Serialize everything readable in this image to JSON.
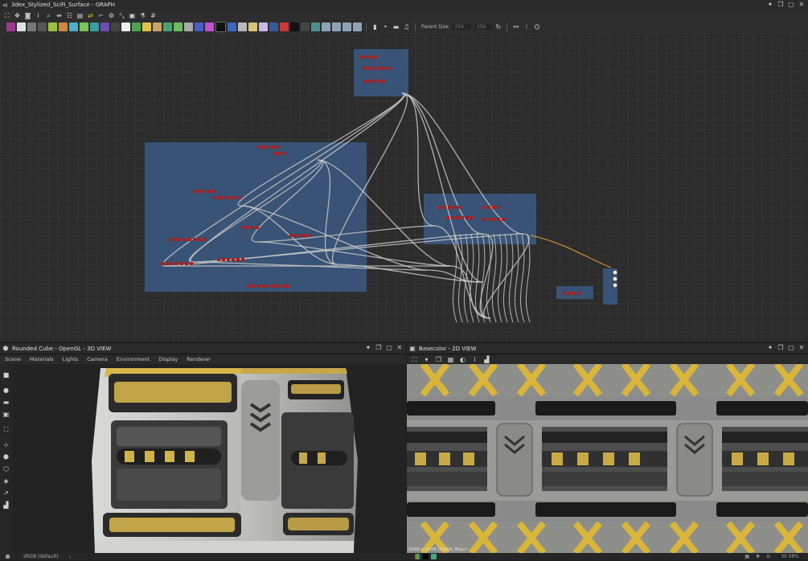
{
  "graph_window": {
    "title": "3dex_Stylized_SciFi_Surface - GRAPH",
    "parent_size_label": "Parent Size:",
    "parent_size_value_1": "256",
    "parent_size_value_2": "256"
  },
  "view3d": {
    "title": "Rounded Cube - OpenGL - 3D VIEW",
    "menu": [
      "Scene",
      "Materials",
      "Lights",
      "Camera",
      "Environment",
      "Display",
      "Renderer"
    ],
    "status_text": "sRGB (default)"
  },
  "view2d": {
    "title": "Basecolor - 2D VIEW",
    "info_text": "2048 x 2048 (RGBA, 8bpc)",
    "zoom": "30.09%"
  },
  "colors": {
    "frame_blue": "#3b5b82",
    "wire": "#c8c8c8",
    "output_wire": "#e0a030",
    "node_red": "#b01c1c",
    "hazard_yellow": "#d9b53a"
  }
}
